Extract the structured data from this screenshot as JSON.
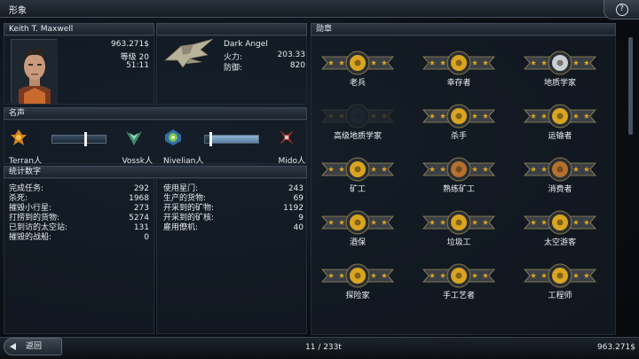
{
  "window": {
    "title": "形象"
  },
  "pilot": {
    "name": "Keith T. Maxwell",
    "money": "963.271$",
    "level": "等级 20",
    "time": "51:11"
  },
  "ship": {
    "name": "Dark Angel",
    "firepower_label": "火力:",
    "firepower_value": "203.33",
    "defense_label": "防御:",
    "defense_value": "820"
  },
  "reputation": {
    "header": "名声",
    "factions": [
      {
        "name": "Terran人",
        "icon": "terran-emblem-icon"
      },
      {
        "name": "Vossk人",
        "icon": "vossk-emblem-icon"
      },
      {
        "name": "Nivelian人",
        "icon": "nivelian-emblem-icon"
      },
      {
        "name": "Mido人",
        "icon": "mido-emblem-icon"
      }
    ],
    "terran_vossk_level": 0.6,
    "nivelian_mido_level": 0.08
  },
  "stats": {
    "header": "统计数字",
    "left": [
      {
        "label": "完成任务:",
        "value": "292"
      },
      {
        "label": "杀死:",
        "value": "1968"
      },
      {
        "label": "摧毁小行星:",
        "value": "273"
      },
      {
        "label": "打捞到的货物:",
        "value": "5274"
      },
      {
        "label": "已到访的太空站:",
        "value": "131"
      },
      {
        "label": "摧毁的战船:",
        "value": "0"
      }
    ],
    "right": [
      {
        "label": "使用星门:",
        "value": "243"
      },
      {
        "label": "生产的货物:",
        "value": "69"
      },
      {
        "label": "开采到的矿物:",
        "value": "1192"
      },
      {
        "label": "开采到的矿核:",
        "value": "9"
      },
      {
        "label": "雇用僚机:",
        "value": "40"
      }
    ]
  },
  "medals": {
    "header": "勋章",
    "items": [
      {
        "label": "老兵",
        "icon": "veteran-medal-icon",
        "earned": true
      },
      {
        "label": "幸存者",
        "icon": "survivor-medal-icon",
        "earned": true
      },
      {
        "label": "地质学家",
        "icon": "geologist-medal-icon",
        "earned": true
      },
      {
        "label": "高级地质学家",
        "icon": "senior-geologist-medal-icon",
        "earned": false
      },
      {
        "label": "杀手",
        "icon": "killer-medal-icon",
        "earned": true
      },
      {
        "label": "运输者",
        "icon": "transporter-medal-icon",
        "earned": true
      },
      {
        "label": "矿工",
        "icon": "miner-medal-icon",
        "earned": true
      },
      {
        "label": "熟练矿工",
        "icon": "skilled-miner-medal-icon",
        "earned": true
      },
      {
        "label": "消费者",
        "icon": "consumer-medal-icon",
        "earned": true
      },
      {
        "label": "酒保",
        "icon": "bartender-medal-icon",
        "earned": true
      },
      {
        "label": "垃圾工",
        "icon": "scavenger-medal-icon",
        "earned": true
      },
      {
        "label": "太空游客",
        "icon": "space-tourist-medal-icon",
        "earned": true
      },
      {
        "label": "探险家",
        "icon": "explorer-medal-icon",
        "earned": true
      },
      {
        "label": "手工艺者",
        "icon": "craftsman-medal-icon",
        "earned": true
      },
      {
        "label": "工程师",
        "icon": "engineer-medal-icon",
        "earned": true
      }
    ]
  },
  "footer": {
    "back_label": "返回",
    "cargo": "11 / 233t",
    "money": "963.271$"
  },
  "colors": {
    "medal_gold": "#d9a520",
    "medal_bronze": "#b5702e",
    "medal_silver": "#c9ced4"
  }
}
